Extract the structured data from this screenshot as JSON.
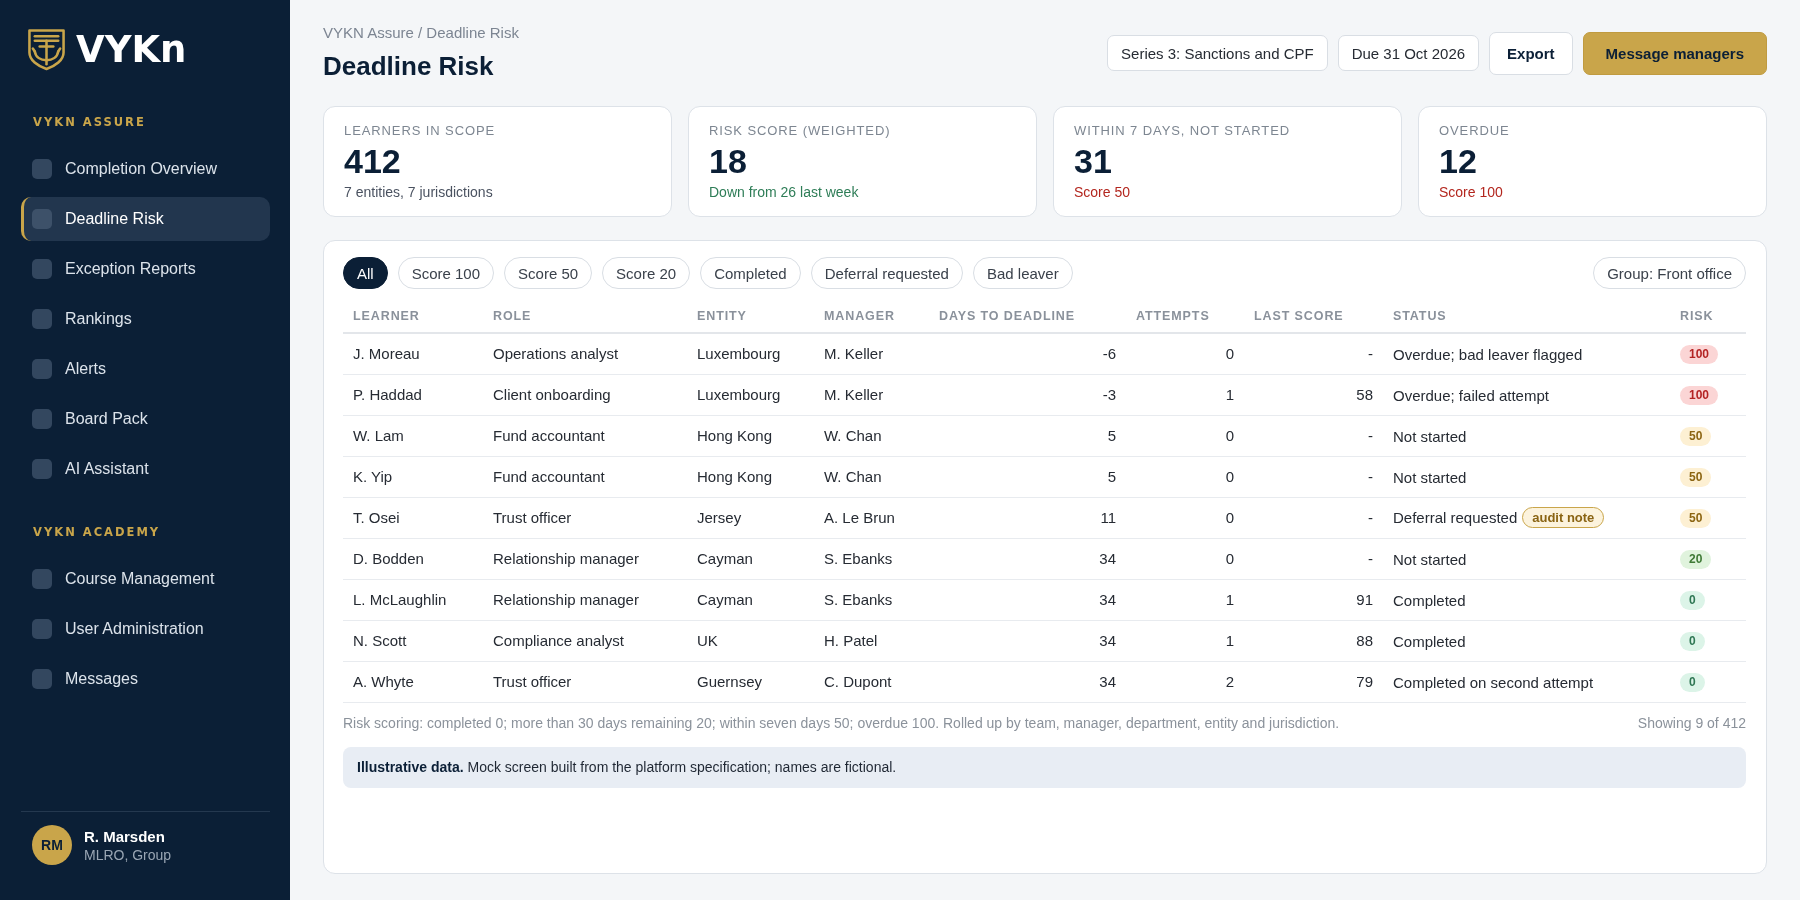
{
  "sidebar": {
    "logo": {
      "wordmark": "VYKn"
    },
    "sections": [
      {
        "heading": "VYKN ASSURE",
        "items": [
          {
            "label": "Completion Overview",
            "selected": false
          },
          {
            "label": "Deadline Risk",
            "selected": true
          },
          {
            "label": "Exception Reports",
            "selected": false
          },
          {
            "label": "Rankings",
            "selected": false
          },
          {
            "label": "Alerts",
            "selected": false
          },
          {
            "label": "Board Pack",
            "selected": false
          },
          {
            "label": "AI Assistant",
            "selected": false
          }
        ]
      },
      {
        "heading": "VYKN ACADEMY",
        "items": [
          {
            "label": "Course Management",
            "selected": false
          },
          {
            "label": "User Administration",
            "selected": false
          },
          {
            "label": "Messages",
            "selected": false
          }
        ]
      }
    ],
    "user": {
      "initials": "RM",
      "name": "R. Marsden",
      "role": "MLRO, Group"
    }
  },
  "header": {
    "breadcrumb": "VYKN Assure / Deadline Risk",
    "title": "Deadline Risk",
    "actions": [
      {
        "label": "Series 3: Sanctions and CPF",
        "kind": "select"
      },
      {
        "label": "Due 31 Oct 2026",
        "kind": "select"
      },
      {
        "label": "Export",
        "kind": "secondary"
      },
      {
        "label": "Message managers",
        "kind": "primary"
      }
    ]
  },
  "stats": [
    {
      "label": "LEARNERS IN SCOPE",
      "value": "412",
      "note": "7 entities, 7 jurisdictions",
      "color": "#4a5260"
    },
    {
      "label": "RISK SCORE (WEIGHTED)",
      "value": "18",
      "note": "Down from 26 last week",
      "color": "#2e7d57"
    },
    {
      "label": "WITHIN 7 DAYS, NOT STARTED",
      "value": "31",
      "note": "Score 50",
      "color": "#b3261e"
    },
    {
      "label": "OVERDUE",
      "value": "12",
      "note": "Score 100",
      "color": "#b3261e"
    }
  ],
  "filters": {
    "chips": [
      {
        "label": "All",
        "selected": true
      },
      {
        "label": "Score 100",
        "selected": false
      },
      {
        "label": "Score 50",
        "selected": false
      },
      {
        "label": "Score 20",
        "selected": false
      },
      {
        "label": "Completed",
        "selected": false
      },
      {
        "label": "Deferral requested",
        "selected": false
      },
      {
        "label": "Bad leaver",
        "selected": false
      }
    ],
    "group": "Group: Front office"
  },
  "table": {
    "columns": [
      "LEARNER",
      "ROLE",
      "ENTITY",
      "MANAGER",
      "DAYS TO DEADLINE",
      "ATTEMPTS",
      "LAST SCORE",
      "STATUS",
      "RISK"
    ],
    "rows": [
      {
        "cells": [
          "J. Moreau",
          "Operations analyst",
          "Luxembourg",
          "M. Keller",
          "-6",
          "0",
          "-",
          "Overdue; bad leaver flagged"
        ],
        "risk": {
          "label": "100",
          "color": "#b42323"
        }
      },
      {
        "cells": [
          "P. Haddad",
          "Client onboarding",
          "Luxembourg",
          "M. Keller",
          "-3",
          "1",
          "58",
          "Overdue; failed attempt"
        ],
        "risk": {
          "label": "100",
          "color": "#b42323"
        }
      },
      {
        "cells": [
          "W. Lam",
          "Fund accountant",
          "Hong Kong",
          "W. Chan",
          "5",
          "0",
          "-",
          "Not started"
        ],
        "risk": {
          "label": "50",
          "color": "#8c6512"
        }
      },
      {
        "cells": [
          "K. Yip",
          "Fund accountant",
          "Hong Kong",
          "W. Chan",
          "5",
          "0",
          "-",
          "Not started"
        ],
        "risk": {
          "label": "50",
          "color": "#8c6512"
        }
      },
      {
        "cells": [
          "T. Osei",
          "Trust officer",
          "Jersey",
          "A. Le Brun",
          "11",
          "0",
          "-",
          "Deferral requested"
        ],
        "tag": "audit note",
        "risk": {
          "label": "50",
          "color": "#8c6512"
        }
      },
      {
        "cells": [
          "D. Bodden",
          "Relationship manager",
          "Cayman",
          "S. Ebanks",
          "34",
          "0",
          "-",
          "Not started"
        ],
        "risk": {
          "label": "20",
          "color": "#3f7a36"
        }
      },
      {
        "cells": [
          "L. McLaughlin",
          "Relationship manager",
          "Cayman",
          "S. Ebanks",
          "34",
          "1",
          "91",
          "Completed"
        ],
        "risk": {
          "label": "0",
          "color": "#2f7754"
        }
      },
      {
        "cells": [
          "N. Scott",
          "Compliance analyst",
          "UK",
          "H. Patel",
          "34",
          "1",
          "88",
          "Completed"
        ],
        "risk": {
          "label": "0",
          "color": "#2f7754"
        }
      },
      {
        "cells": [
          "A. Whyte",
          "Trust officer",
          "Guernsey",
          "C. Dupont",
          "34",
          "2",
          "79",
          "Completed on second attempt"
        ],
        "risk": {
          "label": "0",
          "color": "#2f7754"
        }
      }
    ]
  },
  "footnote": "Risk scoring: completed 0; more than 30 days remaining 20; within seven days 50; overdue 100. Rolled up by team, manager, department, entity and jurisdiction.",
  "count": "Showing 9 of 412",
  "notice": "**Illustrative data.** Mock screen built from the platform specification; names are fictional."
}
